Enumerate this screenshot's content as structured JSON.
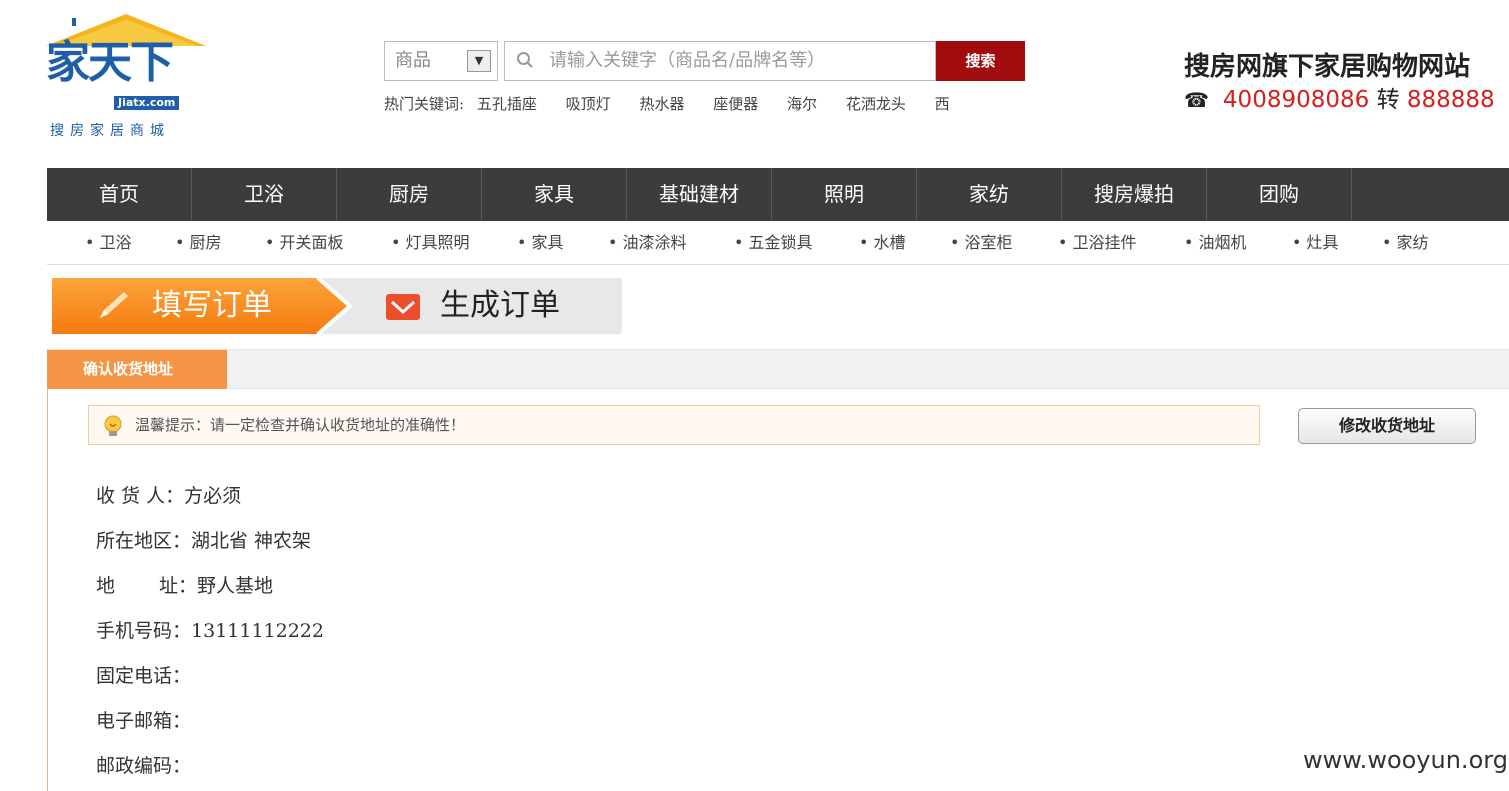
{
  "logo": {
    "main": "家天下",
    "badge": "Jiatx.com",
    "tagline": "搜房家居商城"
  },
  "search": {
    "category": "商品",
    "placeholder": "请输入关键字（商品名/品牌名等）",
    "button": "搜索",
    "hot_label": "热门关键词:",
    "hot_words": [
      "五孔插座",
      "吸顶灯",
      "热水器",
      "座便器",
      "海尔",
      "花洒龙头",
      "西"
    ]
  },
  "brand": {
    "title": "搜房网旗下家居购物网站",
    "phone": "4008908086",
    "phone_mid": "转",
    "ext": "888888"
  },
  "main_nav": [
    "首页",
    "卫浴",
    "厨房",
    "家具",
    "基础建材",
    "照明",
    "家纺",
    "搜房爆拍",
    "团购"
  ],
  "sub_nav": [
    "卫浴",
    "厨房",
    "开关面板",
    "灯具照明",
    "家具",
    "油漆涂料",
    "五金锁具",
    "水槽",
    "浴室柜",
    "卫浴挂件",
    "油烟机",
    "灶具",
    "家纺"
  ],
  "steps": {
    "step1": "填写订单",
    "step2": "生成订单"
  },
  "address": {
    "tab": "确认收货地址",
    "tip": "温馨提示：请一定检查并确认收货地址的准确性！",
    "edit_button": "修改收货地址",
    "fields": [
      {
        "label": "收 货 人：",
        "value": "方必须"
      },
      {
        "label": "所在地区：",
        "value": "湖北省 神农架"
      },
      {
        "label": "地　　 址：",
        "value": "野人基地"
      },
      {
        "label": "手机号码：",
        "value": "13111112222"
      },
      {
        "label": "固定电话：",
        "value": ""
      },
      {
        "label": "电子邮箱：",
        "value": ""
      },
      {
        "label": "邮政编码：",
        "value": ""
      }
    ]
  },
  "watermark": "www.wooyun.org",
  "colors": {
    "nav_bg": "#3c3c3c",
    "accent_orange": "#f79547",
    "search_button": "#a30c0f",
    "brand_blue": "#1f5fa8",
    "hotline_red": "#d42020"
  }
}
